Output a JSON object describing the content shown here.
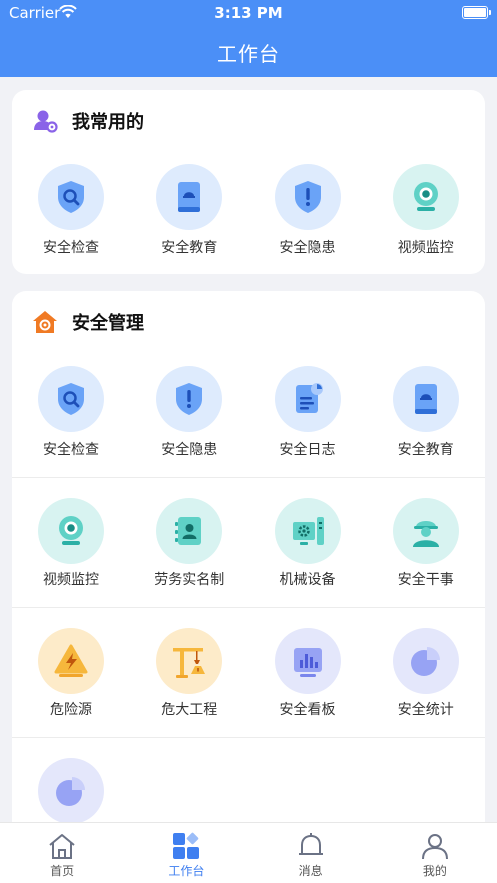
{
  "status_bar": {
    "carrier": "Carrier",
    "time": "3:13 PM"
  },
  "header": {
    "title": "工作台"
  },
  "favorites": {
    "title": "我常用的",
    "items": [
      {
        "label": "安全检查",
        "icon": "shield-search-icon"
      },
      {
        "label": "安全教育",
        "icon": "book-icon"
      },
      {
        "label": "安全隐患",
        "icon": "shield-alert-icon"
      },
      {
        "label": "视频监控",
        "icon": "camera-icon"
      }
    ]
  },
  "management": {
    "title": "安全管理",
    "rows": [
      [
        {
          "label": "安全检查",
          "icon": "shield-search-icon"
        },
        {
          "label": "安全隐患",
          "icon": "shield-alert-icon"
        },
        {
          "label": "安全日志",
          "icon": "log-icon"
        },
        {
          "label": "安全教育",
          "icon": "book-icon"
        }
      ],
      [
        {
          "label": "视频监控",
          "icon": "camera-icon"
        },
        {
          "label": "劳务实名制",
          "icon": "id-card-icon"
        },
        {
          "label": "机械设备",
          "icon": "machine-icon"
        },
        {
          "label": "安全干事",
          "icon": "worker-icon"
        }
      ],
      [
        {
          "label": "危险源",
          "icon": "hazard-icon"
        },
        {
          "label": "危大工程",
          "icon": "crane-icon"
        },
        {
          "label": "安全看板",
          "icon": "dashboard-icon"
        },
        {
          "label": "安全统计",
          "icon": "pie-chart-icon"
        }
      ],
      [
        {
          "label": "",
          "icon": "pie-chart-icon"
        }
      ]
    ]
  },
  "tabbar": {
    "items": [
      {
        "label": "首页",
        "icon": "home-icon"
      },
      {
        "label": "工作台",
        "icon": "workbench-icon",
        "active": true
      },
      {
        "label": "消息",
        "icon": "bell-icon"
      },
      {
        "label": "我的",
        "icon": "user-icon"
      }
    ]
  },
  "colors": {
    "primary": "#4b8ff7",
    "active_tab": "#3f7ff0"
  }
}
